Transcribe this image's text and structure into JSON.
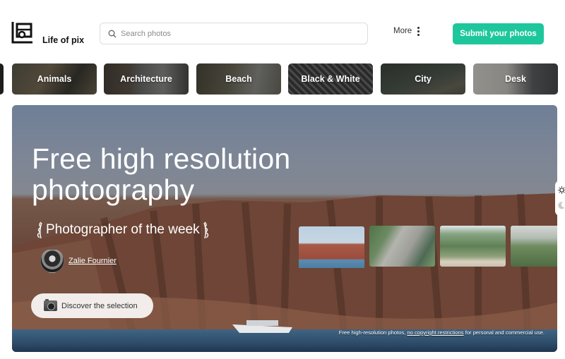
{
  "header": {
    "brand": "Life of pix",
    "search_placeholder": "Search photos",
    "more_label": "More",
    "submit_label": "Submit your photos",
    "accent_color": "#1ec79b"
  },
  "categories": [
    {
      "label": ""
    },
    {
      "label": "Animals"
    },
    {
      "label": "Architecture"
    },
    {
      "label": "Beach"
    },
    {
      "label": "Black & White"
    },
    {
      "label": "City"
    },
    {
      "label": "Desk"
    }
  ],
  "hero": {
    "title_line1": "Free high resolution",
    "title_line2": "photography",
    "photographer_heading": "Photographer of the week",
    "photographer_name": "Zalie Fournier",
    "discover_label": "Discover the selection",
    "thumbnails": [
      {
        "icon": "cliff-sea-photo"
      },
      {
        "icon": "waterfall-photo"
      },
      {
        "icon": "mountain-road-photo"
      },
      {
        "icon": "green-field-photo"
      }
    ],
    "footnote_pre": "Free high-resolution photos, ",
    "footnote_link": "no copyright restrictions",
    "footnote_post": " for personal and commercial use."
  },
  "theme_toggle": {
    "light_icon": "sun-icon",
    "dark_icon": "moon-icon"
  }
}
